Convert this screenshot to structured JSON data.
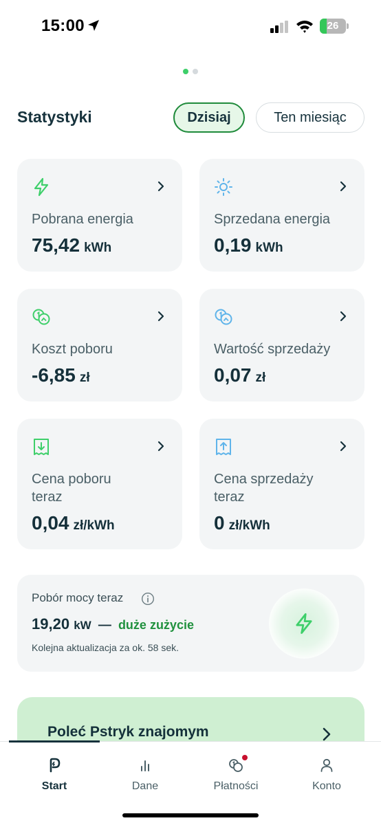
{
  "status_bar": {
    "time": "15:00",
    "battery": "26",
    "battery_level_percent": 26
  },
  "pager": {
    "pages": 2,
    "active_index": 0
  },
  "stats": {
    "title": "Statystyki",
    "periods": [
      {
        "label": "Dzisiaj",
        "active": true
      },
      {
        "label": "Ten miesiąc",
        "active": false
      }
    ],
    "cards": [
      {
        "icon": "lightning-bolt-icon",
        "label": "Pobrana energia",
        "value": "75,42",
        "unit": "kWh",
        "color": "#3ecf6a"
      },
      {
        "icon": "sun-icon",
        "label": "Sprzedana energia",
        "value": "0,19",
        "unit": "kWh",
        "color": "#5fb4ea"
      },
      {
        "icon": "coins-icon",
        "label": "Koszt poboru",
        "value": "-6,85",
        "unit": "zł",
        "color": "#3ecf6a"
      },
      {
        "icon": "coins-icon",
        "label": "Wartość sprzedaży",
        "value": "0,07",
        "unit": "zł",
        "color": "#5fb4ea"
      },
      {
        "icon": "receipt-download-icon",
        "label": "Cena poboru\nteraz",
        "value": "0,04",
        "unit": "zł/kWh",
        "color": "#3ecf6a"
      },
      {
        "icon": "receipt-upload-icon",
        "label": "Cena sprzedaży\nteraz",
        "value": "0",
        "unit": "zł/kWh",
        "color": "#5fb4ea"
      }
    ]
  },
  "power": {
    "title": "Pobór mocy teraz",
    "value": "19,20",
    "unit": "kW",
    "separator": "—",
    "status": "duże zużycie",
    "note": "Kolejna aktualizacja za ok. 58 sek."
  },
  "promo": {
    "text": "Poleć Pstryk znajomym"
  },
  "tabs": [
    {
      "label": "Start",
      "icon": "pstryk-logo-icon",
      "active": true
    },
    {
      "label": "Dane",
      "icon": "bar-chart-icon",
      "active": false
    },
    {
      "label": "Płatności",
      "icon": "coins-icon",
      "active": false,
      "badge": true
    },
    {
      "label": "Konto",
      "icon": "user-icon",
      "active": false
    }
  ],
  "colors": {
    "accent_green": "#3ecf6a",
    "accent_blue": "#5fb4ea",
    "text_dark": "#16323c",
    "status_green": "#20913e",
    "badge_red": "#c8102e"
  }
}
